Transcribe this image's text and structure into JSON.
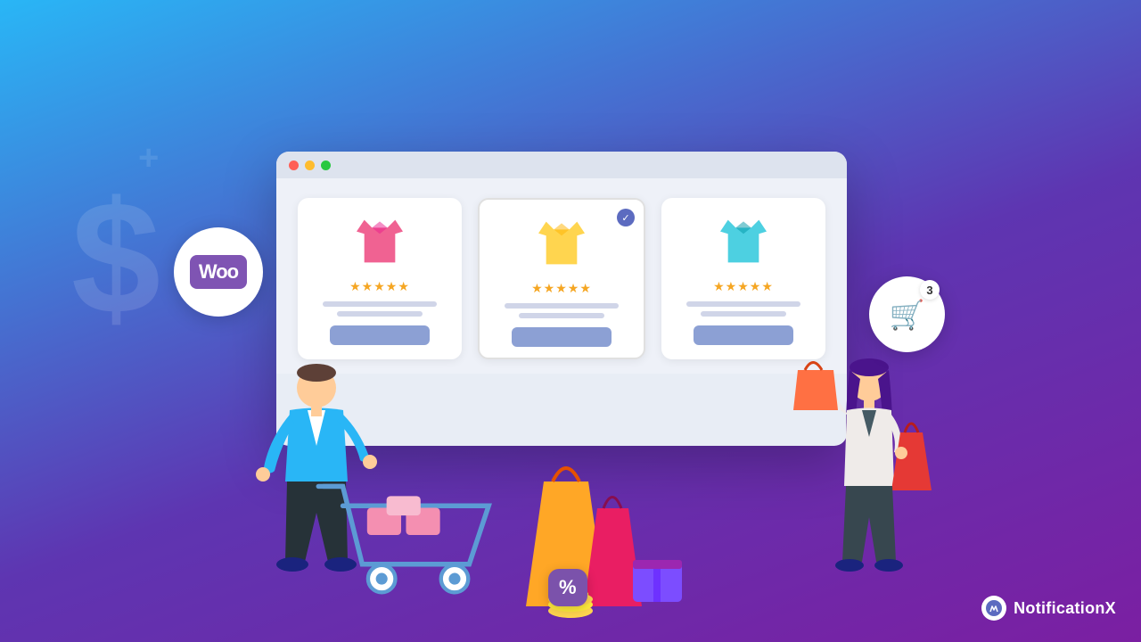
{
  "background": {
    "gradient_start": "#29b6f6",
    "gradient_end": "#7b1fa2"
  },
  "woo_badge": {
    "text": "Woo",
    "bg_color": "#7f54b3"
  },
  "cart_badge": {
    "count": "3",
    "icon": "🛒"
  },
  "browser": {
    "dots": [
      "#ff5f57",
      "#febc2e",
      "#28c840"
    ],
    "products": [
      {
        "id": 1,
        "shirt_color": "#f06292",
        "stars": "★★★★★",
        "featured": false
      },
      {
        "id": 2,
        "shirt_color": "#ffd54f",
        "stars": "★★★★★",
        "featured": true
      },
      {
        "id": 3,
        "shirt_color": "#4dd0e1",
        "stars": "★★★★★",
        "featured": false
      }
    ]
  },
  "branding": {
    "name": "NotificationX",
    "logo_letter": "N"
  },
  "percent_badge": {
    "text": "%"
  },
  "dollar_sign": "$"
}
